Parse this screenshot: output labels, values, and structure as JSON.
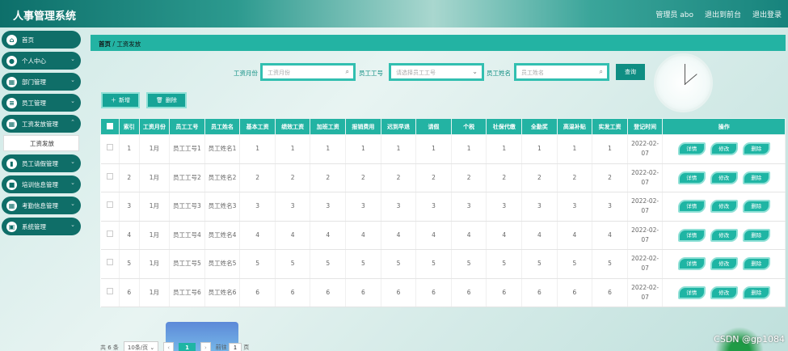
{
  "app": {
    "title": "人事管理系统"
  },
  "top_links": {
    "user": "管理员 abo",
    "back": "退出到前台",
    "logout": "退出登录"
  },
  "sidebar": {
    "items": [
      {
        "label": "首页",
        "icon": "home-icon"
      },
      {
        "label": "个人中心",
        "icon": "user-icon"
      },
      {
        "label": "部门管理",
        "icon": "grid-icon"
      },
      {
        "label": "员工管理",
        "icon": "list-icon"
      },
      {
        "label": "工资发放管理",
        "icon": "grid-icon"
      },
      {
        "label": "员工请假管理",
        "icon": "chart-icon"
      },
      {
        "label": "培训信息管理",
        "icon": "chat-icon"
      },
      {
        "label": "考勤信息管理",
        "icon": "grid-icon"
      },
      {
        "label": "系统管理",
        "icon": "box-icon"
      }
    ],
    "active_submenu": "工资发放"
  },
  "breadcrumb": {
    "home": "首页",
    "sep": "/",
    "current": "工资发放"
  },
  "search": {
    "month_label": "工资月份",
    "month_placeholder": "工资月份",
    "empno_label": "员工工号",
    "empno_placeholder": "请选择员工工号",
    "name_label": "员工姓名",
    "name_placeholder": "员工姓名",
    "button": "查询"
  },
  "actions": {
    "add": "新增",
    "delete": "删除"
  },
  "table": {
    "headers": [
      "索引",
      "工资月份",
      "员工工号",
      "员工姓名",
      "基本工资",
      "绩效工资",
      "加班工资",
      "报销费用",
      "迟到早退",
      "请假",
      "个税",
      "社保代缴",
      "全勤奖",
      "高温补贴",
      "实发工资",
      "登记时间",
      "操作"
    ],
    "rows": [
      [
        "1",
        "1月",
        "员工工号1",
        "员工姓名1",
        "1",
        "1",
        "1",
        "1",
        "1",
        "1",
        "1",
        "1",
        "1",
        "1",
        "1",
        "2022-02-07"
      ],
      [
        "2",
        "1月",
        "员工工号2",
        "员工姓名2",
        "2",
        "2",
        "2",
        "2",
        "2",
        "2",
        "2",
        "2",
        "2",
        "2",
        "2",
        "2022-02-07"
      ],
      [
        "3",
        "1月",
        "员工工号3",
        "员工姓名3",
        "3",
        "3",
        "3",
        "3",
        "3",
        "3",
        "3",
        "3",
        "3",
        "3",
        "3",
        "2022-02-07"
      ],
      [
        "4",
        "1月",
        "员工工号4",
        "员工姓名4",
        "4",
        "4",
        "4",
        "4",
        "4",
        "4",
        "4",
        "4",
        "4",
        "4",
        "4",
        "2022-02-07"
      ],
      [
        "5",
        "1月",
        "员工工号5",
        "员工姓名5",
        "5",
        "5",
        "5",
        "5",
        "5",
        "5",
        "5",
        "5",
        "5",
        "5",
        "5",
        "2022-02-07"
      ],
      [
        "6",
        "1月",
        "员工工号6",
        "员工姓名6",
        "6",
        "6",
        "6",
        "6",
        "6",
        "6",
        "6",
        "6",
        "6",
        "6",
        "6",
        "2022-02-07"
      ]
    ],
    "row_actions": {
      "detail": "详情",
      "edit": "修改",
      "delete": "删除"
    }
  },
  "pager": {
    "total": "共 6 条",
    "page_size": "10条/页",
    "current": "1",
    "goto_label": "前往",
    "goto_value": "1",
    "goto_suffix": "页"
  },
  "watermark": "CSDN @gp1084"
}
